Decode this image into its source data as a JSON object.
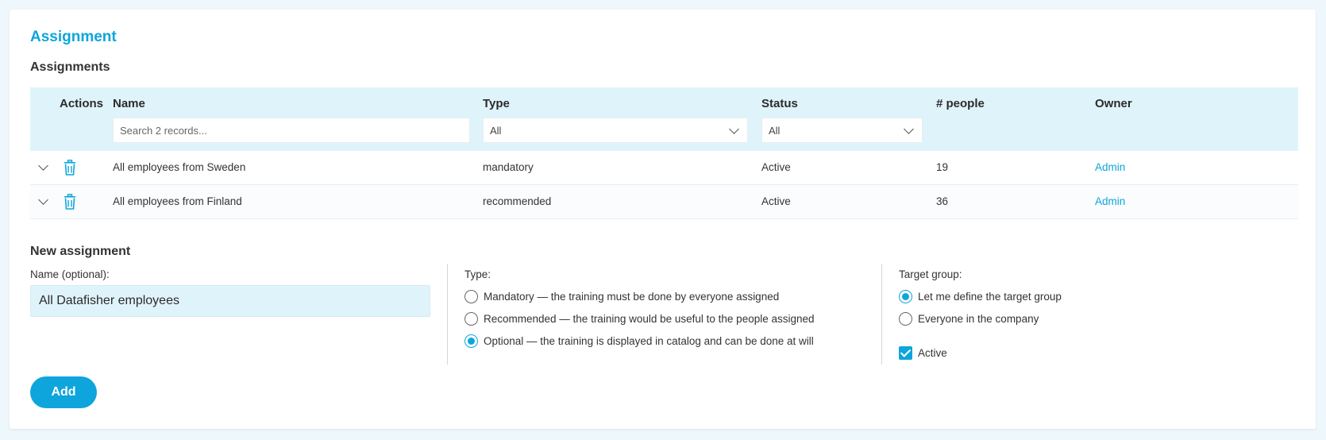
{
  "section_title": "Assignment",
  "table": {
    "title": "Assignments",
    "headers": {
      "actions": "Actions",
      "name": "Name",
      "type": "Type",
      "status": "Status",
      "people": "# people",
      "owner": "Owner"
    },
    "filters": {
      "search_placeholder": "Search 2 records...",
      "type_value": "All",
      "status_value": "All"
    },
    "rows": [
      {
        "name": "All employees from Sweden",
        "type": "mandatory",
        "status": "Active",
        "people": "19",
        "owner": "Admin"
      },
      {
        "name": "All employees from Finland",
        "type": "recommended",
        "status": "Active",
        "people": "36",
        "owner": "Admin"
      }
    ]
  },
  "new_assignment": {
    "title": "New assignment",
    "name_label": "Name (optional):",
    "name_value": "All Datafisher employees",
    "type_label": "Type:",
    "type_options": [
      {
        "label": "Mandatory — the training must be done by everyone assigned",
        "checked": false
      },
      {
        "label": "Recommended — the training would be useful to the people assigned",
        "checked": false
      },
      {
        "label": "Optional — the training is displayed in catalog and can be done at will",
        "checked": true
      }
    ],
    "target_label": "Target group:",
    "target_options": [
      {
        "label": "Let me define the target group",
        "checked": true
      },
      {
        "label": "Everyone in the company",
        "checked": false
      }
    ],
    "active_label": "Active",
    "active_checked": true,
    "add_label": "Add"
  },
  "colors": {
    "accent": "#0ea5dc",
    "header_bg": "#dff3fb"
  }
}
